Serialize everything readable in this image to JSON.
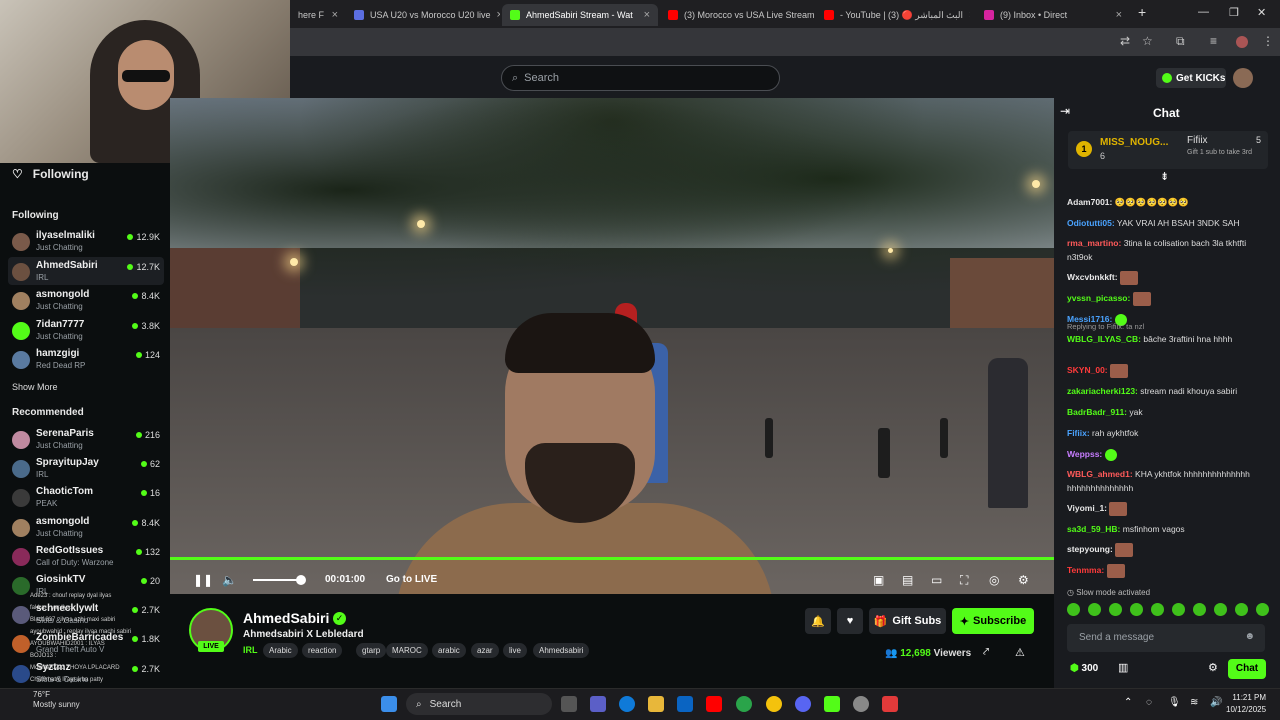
{
  "browser": {
    "tabs": [
      {
        "label": "here F",
        "color": "#888888"
      },
      {
        "label": "USA U20 vs Morocco U20 live",
        "color": "#5b6ee1"
      },
      {
        "label": "AhmedSabiri Stream - Wat",
        "color": "#53fc18"
      },
      {
        "label": "(3) Morocco vs USA Live Stream",
        "color": "#ff0000"
      },
      {
        "label": "- YouTube | البث المباشر 🔴 (3)",
        "color": "#ff0000"
      },
      {
        "label": "(9) Inbox • Direct",
        "color": "#d6249f"
      }
    ],
    "new_tab": "+"
  },
  "site": {
    "search_placeholder": "Search",
    "get_kicks": "Get KICKs"
  },
  "sidebar": {
    "following_header": "Following",
    "following_title": "Following",
    "following": [
      {
        "name": "ilyaselmaliki",
        "category": "Just Chatting",
        "viewers": "12.9K",
        "color": "#7a5a4a"
      },
      {
        "name": "AhmedSabiri",
        "category": "IRL",
        "viewers": "12.7K",
        "color": "#6b5040"
      },
      {
        "name": "asmongold",
        "category": "Just Chatting",
        "viewers": "8.4K",
        "color": "#a08060"
      },
      {
        "name": "7idan7777",
        "category": "Just Chatting",
        "viewers": "3.8K",
        "color": "#53fc18"
      },
      {
        "name": "hamzgigi",
        "category": "Red Dead RP",
        "viewers": "124",
        "color": "#5a7aa0"
      }
    ],
    "show_more": "Show More",
    "recommended_title": "Recommended",
    "recommended": [
      {
        "name": "SerenaParis",
        "category": "Just Chatting",
        "viewers": "216",
        "color": "#c08aa0"
      },
      {
        "name": "SprayitupJay",
        "category": "IRL",
        "viewers": "62",
        "color": "#4a6a8a"
      },
      {
        "name": "ChaoticTom",
        "category": "PEAK",
        "viewers": "16",
        "color": "#3a3a3a"
      },
      {
        "name": "asmongold",
        "category": "Just Chatting",
        "viewers": "8.4K",
        "color": "#a08060"
      },
      {
        "name": "RedGotIssues",
        "category": "Call of Duty: Warzone",
        "viewers": "132",
        "color": "#8a2a5a"
      },
      {
        "name": "GiosinkTV",
        "category": "IRL",
        "viewers": "20",
        "color": "#2a6a2a"
      },
      {
        "name": "schnecklywlt",
        "category": "Slots & Casino",
        "viewers": "2.7K",
        "color": "#5a5a7a"
      },
      {
        "name": "ZombieBarricades",
        "category": "Grand Theft Auto V",
        "viewers": "1.8K",
        "color": "#c0602a"
      },
      {
        "name": "Syztmz",
        "category": "Slots & Casino",
        "viewers": "2.7K",
        "color": "#2a4a8a"
      }
    ],
    "overlay_lines": [
      "Ade23 : chouf replay dyal ilyas",
      "fakkar : yar ilyas",
      "Blad1837 : ilyas azbi maxi sabiri",
      "ayoubwahid : replay ilyaa machi sabiri",
      "AYOUBWAHID2001 : ILYAS",
      "BOJO13 :",
      "Mokhtar0223 : HOYA LPLACARD",
      "Chat9matni l7ayt a ba patty"
    ],
    "weather": "Mostly sunny",
    "temp": "76°F"
  },
  "player": {
    "time": "00:01:00",
    "go_live": "Go to LIVE",
    "progress": 1.0,
    "volume": 0.85
  },
  "stream": {
    "name": "AhmedSabiri",
    "title": "Ahmedsabiri X Lebledard",
    "category": "IRL",
    "tags": [
      "Arabic",
      "reaction",
      "gtarp",
      "MAROC",
      "arabic",
      "azar",
      "live",
      "Ahmedsabiri"
    ],
    "live_label": "LIVE",
    "gift_subs": "Gift Subs",
    "subscribe": "Subscribe",
    "viewers": "12,698",
    "viewers_label": "Viewers"
  },
  "chat": {
    "title": "Chat",
    "pinned": {
      "rank": "1",
      "user": "MISS_NOUG...",
      "count": "6",
      "gifter": "Fifiix",
      "gifter_count": "5",
      "note": "Gift 1 sub to take 3rd"
    },
    "messages": [
      {
        "user": "Adam7001:",
        "text": "🥺🥺🥺🥺🥺🥺🥺",
        "color": "#e8e8e8"
      },
      {
        "user": "Odiotutti05:",
        "text": "YAK VRAI AH BSAH 3NDK SAH",
        "color": "#4aa3ff"
      },
      {
        "user": "rma_martino:",
        "text": "3tina la colisation bach 3la tkhtfti n3t9ok",
        "color": "#ff5a5a"
      },
      {
        "user": "Wxcvbnkkft:",
        "text": "",
        "color": "#e8e8e8",
        "emote": true
      },
      {
        "user": "yvssn_picasso:",
        "text": "",
        "color": "#53fc18",
        "emote": true
      },
      {
        "user": "Messi1716:",
        "text": "",
        "color": "#4aa3ff",
        "gemote": true
      },
      {
        "reply": "Replying to Fifiix: ta nzl",
        "user": "WBLG_ILYAS_CB:",
        "text": "bâche 3raftini hna hhhh",
        "color": "#53fc18"
      },
      {
        "user": "SKYN_00:",
        "text": "",
        "color": "#ff3b3b",
        "emote": true
      },
      {
        "user": "zakariacherki123:",
        "text": "stream nadi khouya sabiri",
        "color": "#53fc18"
      },
      {
        "user": "BadrBadr_911:",
        "text": "yak",
        "color": "#53fc18"
      },
      {
        "user": "Fifiix:",
        "text": "rah aykhtfok",
        "color": "#4aa3ff"
      },
      {
        "user": "Weppss:",
        "text": "",
        "color": "#c77dff",
        "gemote": true
      },
      {
        "user": "WBLG_ahmed1:",
        "text": "KHA ykhtfok hhhhhhhhhhhhhh hhhhhhhhhhhhhh",
        "color": "#ff5a5a"
      },
      {
        "user": "Viyomi_1:",
        "text": "",
        "color": "#e8e8e8",
        "emote": true
      },
      {
        "user": "sa3d_59_HB:",
        "text": "msfinhom vagos",
        "color": "#53fc18"
      },
      {
        "user": "stepyoung:",
        "text": "",
        "color": "#e8e8e8",
        "emote": true
      },
      {
        "user": "Tenmma:",
        "text": "",
        "color": "#ff3b3b",
        "emote": true
      }
    ],
    "slow_mode": "Slow mode activated",
    "send_placeholder": "Send a message",
    "points": "300",
    "chat_button": "Chat"
  },
  "taskbar": {
    "search": "Search",
    "time": "11:21 PM",
    "date": "10/12/2025"
  }
}
